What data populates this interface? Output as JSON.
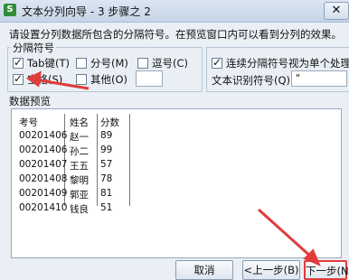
{
  "window": {
    "title": "文本分列向导 - 3 步骤之 2",
    "app_icon_letter": "S",
    "close_glyph": "✕"
  },
  "instruction": "请设置分列数据所包含的分隔符号。在预览窗口内可以看到分列的效果。",
  "delimiters": {
    "group_title": "分隔符号",
    "tab": {
      "label": "Tab键(T)",
      "checked": true
    },
    "semicolon": {
      "label": "分号(M)",
      "checked": false
    },
    "comma": {
      "label": "逗号(C)",
      "checked": false
    },
    "space": {
      "label": "空格(S)",
      "checked": true
    },
    "other": {
      "label": "其他(O)",
      "checked": false,
      "value": ""
    }
  },
  "options": {
    "consecutive": {
      "label": "连续分隔符号视为单个处理(R)",
      "checked": true
    },
    "qualifier_label": "文本识别符号(Q):",
    "qualifier_value": "\""
  },
  "preview": {
    "title": "数据预览",
    "headers": [
      "考号",
      "姓名",
      "分数"
    ],
    "rows": [
      [
        "00201406",
        "赵一",
        "89"
      ],
      [
        "00201406",
        "孙二",
        "99"
      ],
      [
        "00201407",
        "王五",
        "57"
      ],
      [
        "00201408",
        "黎明",
        "78"
      ],
      [
        "00201409",
        "郭亚",
        "81"
      ],
      [
        "00201410",
        "钱良",
        "51"
      ]
    ]
  },
  "buttons": {
    "cancel": "取消",
    "back": "<上一步(B)",
    "next": "下一步(N)"
  },
  "colors": {
    "annotation_arrow": "#e23b3b"
  }
}
